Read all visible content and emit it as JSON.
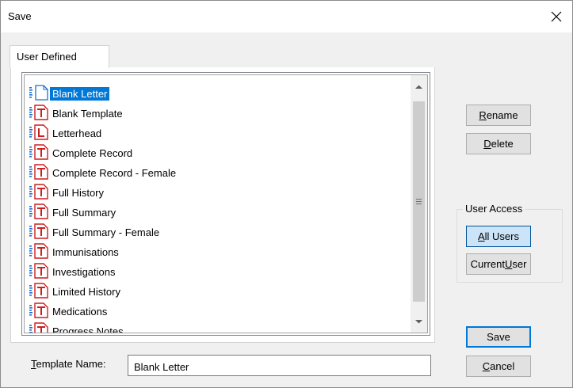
{
  "window": {
    "title": "Save",
    "close_icon": "close-icon"
  },
  "tabs": [
    {
      "label": "User Defined"
    }
  ],
  "templates": [
    {
      "label": "Blank Letter",
      "icon": "blank-document-icon",
      "selected": true
    },
    {
      "label": "Blank Template",
      "icon": "template-document-icon"
    },
    {
      "label": "Letterhead",
      "icon": "letterhead-document-icon"
    },
    {
      "label": "Complete Record",
      "icon": "template-document-icon"
    },
    {
      "label": "Complete Record - Female",
      "icon": "template-document-icon"
    },
    {
      "label": "Full History",
      "icon": "template-document-icon"
    },
    {
      "label": "Full Summary",
      "icon": "template-document-icon"
    },
    {
      "label": "Full Summary - Female",
      "icon": "template-document-icon"
    },
    {
      "label": "Immunisations",
      "icon": "template-document-icon"
    },
    {
      "label": "Investigations",
      "icon": "template-document-icon"
    },
    {
      "label": "Limited History",
      "icon": "template-document-icon"
    },
    {
      "label": "Medications",
      "icon": "template-document-icon"
    },
    {
      "label": "Progress Notes",
      "icon": "template-document-icon"
    }
  ],
  "buttons": {
    "rename": {
      "pre": "",
      "u": "R",
      "post": "ename"
    },
    "delete": {
      "pre": "",
      "u": "D",
      "post": "elete"
    },
    "all_users": {
      "pre": "",
      "u": "A",
      "post": "ll Users"
    },
    "current_user": {
      "pre": "Current ",
      "u": "U",
      "post": "ser"
    },
    "save": {
      "pre": "Save",
      "u": "",
      "post": ""
    },
    "cancel": {
      "pre": "",
      "u": "C",
      "post": "ancel"
    }
  },
  "user_access": {
    "legend": "User Access",
    "selected": "All Users"
  },
  "template_name": {
    "label_u": "T",
    "label_rest": "emplate Name:",
    "value": "Blank Letter"
  },
  "colors": {
    "selection": "#0078d7",
    "default_button_border": "#0078d7",
    "active_button_fill": "#cce4f7",
    "icon_red": "#cc1f1f",
    "icon_blue": "#1a6fd0"
  }
}
